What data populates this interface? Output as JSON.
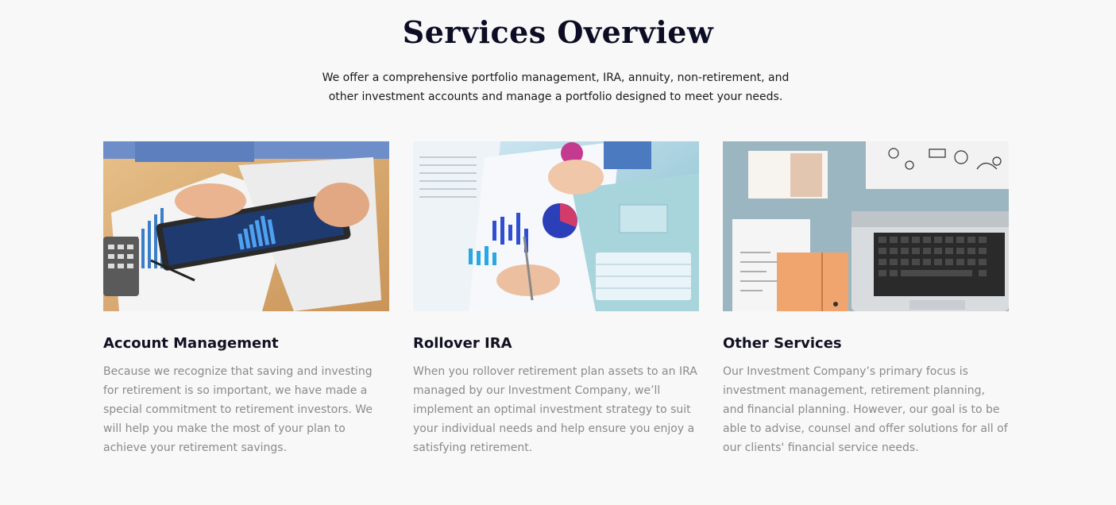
{
  "header": {
    "title": "Services Overview",
    "subtitle": "We offer a comprehensive portfolio management, IRA, annuity, non-retirement, and other investment accounts and manage a portfolio designed to meet your needs."
  },
  "cards": [
    {
      "title": "Account Management",
      "text": "Because we recognize that saving and investing for retirement is so important, we have made a special commitment to retirement investors. We will help you make the most of your plan to achieve your retirement savings.",
      "image": "tablet-financial-charts-photo"
    },
    {
      "title": "Rollover IRA",
      "text": "When you rollover retirement plan assets to an IRA managed by our Investment Company, we’ll implement an optimal investment strategy to suit your individual needs and help ensure you enjoy a satisfying retirement.",
      "image": "charts-laptop-photo"
    },
    {
      "title": "Other Services",
      "text": "Our Investment Company’s primary focus is investment management, retirement planning, and financial planning. However, our goal is to be able to advise, counsel and offer solutions for all of our clients' financial service needs.",
      "image": "laptop-notebooks-desk-photo"
    }
  ],
  "colors": {
    "background": "#f8f8f8",
    "title": "#0c0c24",
    "body_text": "#8a8a8a"
  }
}
